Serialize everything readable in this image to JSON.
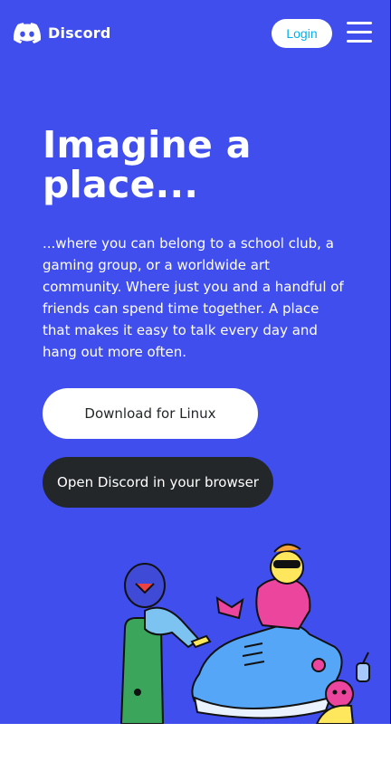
{
  "nav": {
    "brand": "Discord",
    "login_label": "Login",
    "menu_icon": "hamburger-menu-icon"
  },
  "hero": {
    "title": "Imagine a place...",
    "description": "...where you can belong to a school club, a gaming group, or a worldwide art community. Where just you and a handful of friends can spend time together. A place that makes it easy to talk every day and hang out more often.",
    "download_label": "Download for Linux",
    "browser_label": "Open Discord in your browser",
    "illustration": "friends-hanging-out-illustration"
  },
  "colors": {
    "blurple": "#404eed",
    "dark": "#23272a",
    "login_text": "#00b0f4",
    "white": "#ffffff"
  }
}
